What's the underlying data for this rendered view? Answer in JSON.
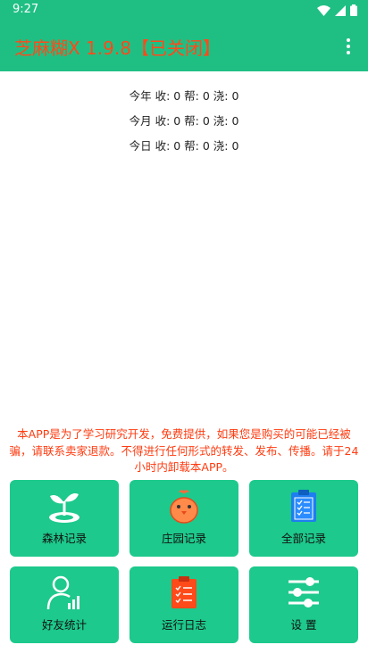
{
  "status_bar": {
    "time": "9:27"
  },
  "app_bar": {
    "title": "芝麻糊X 1.9.8【已关闭】"
  },
  "stats": [
    {
      "period": "今年",
      "text": "收: 0 帮: 0 浇: 0"
    },
    {
      "period": "今月",
      "text": "收: 0 帮: 0 浇: 0"
    },
    {
      "period": "今日",
      "text": "收: 0 帮: 0 浇: 0"
    }
  ],
  "disclaimer": {
    "line1": "本APP是为了学习研究开发，免费提供，如果您是购买的可能已经被",
    "line2": "骗，请联系卖家退款。不得进行任何形式的转发、发布、传播。请于24",
    "line3": "小时内卸载本APP。"
  },
  "tiles": [
    {
      "label": "森林记录",
      "icon": "sprout-icon"
    },
    {
      "label": "庄园记录",
      "icon": "chick-icon"
    },
    {
      "label": "全部记录",
      "icon": "clipboard-icon"
    },
    {
      "label": "好友统计",
      "icon": "user-chart-icon"
    },
    {
      "label": "运行日志",
      "icon": "log-clipboard-icon"
    },
    {
      "label": "设 置",
      "icon": "sliders-icon"
    }
  ],
  "colors": {
    "primary": "#1fbf84",
    "tile": "#1dc98c",
    "title": "#ff4a1a",
    "warning": "#ff3b10"
  }
}
